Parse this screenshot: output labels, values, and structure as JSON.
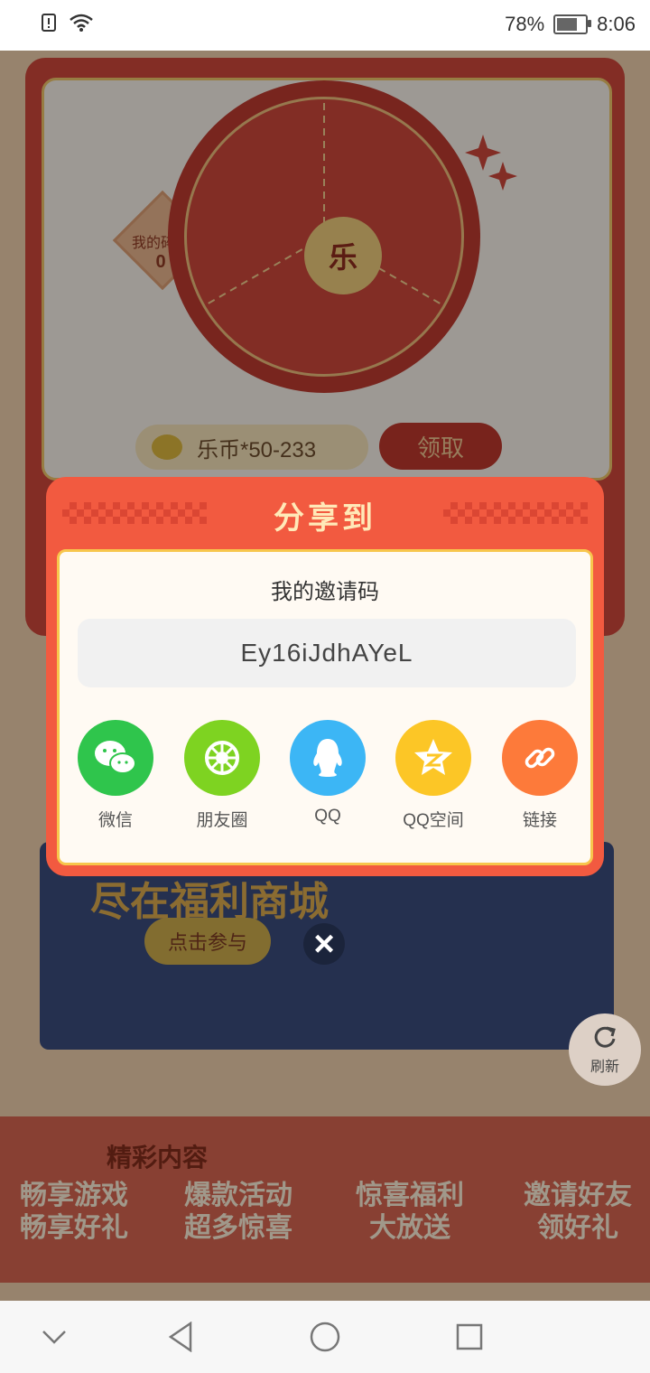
{
  "status_bar": {
    "battery": "78%",
    "time": "8:06"
  },
  "background": {
    "fragments_label": "我的碎片",
    "fragments_count": "0",
    "wheel_center": "乐",
    "coin_text": "乐币*50-233",
    "claim_label": "领取",
    "banner_line": "尽在福利商城",
    "banner_button": "点击参与",
    "section_header": "精彩内容",
    "features": [
      {
        "line1": "畅享游戏",
        "line2": "畅享好礼"
      },
      {
        "line1": "爆款活动",
        "line2": "超多惊喜"
      },
      {
        "line1": "惊喜福利",
        "line2": "大放送"
      },
      {
        "line1": "邀请好友",
        "line2": "领好礼"
      }
    ],
    "refresh_label": "刷新"
  },
  "dialog": {
    "title": "分享到",
    "invite_title": "我的邀请码",
    "invite_code": "Ey16iJdhAYeL",
    "share_targets": [
      {
        "label": "微信",
        "icon": "wechat-icon",
        "color": "#2fc54c"
      },
      {
        "label": "朋友圈",
        "icon": "moments-icon",
        "color": "#7ed321"
      },
      {
        "label": "QQ",
        "icon": "qq-icon",
        "color": "#3cb6f5"
      },
      {
        "label": "QQ空间",
        "icon": "qzone-icon",
        "color": "#fcc626"
      },
      {
        "label": "链接",
        "icon": "link-icon",
        "color": "#fd7a3a"
      }
    ]
  },
  "nav": {
    "icons": [
      "chevron-down-icon",
      "back-icon",
      "home-icon",
      "recents-icon"
    ]
  }
}
